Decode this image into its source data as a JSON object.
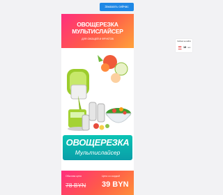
{
  "top_button": {
    "label": "Заказать сейчас"
  },
  "header": {
    "title_line1": "ОВОЩЕРЕЗКА",
    "title_line2": "МУЛЬТИСЛАЙСЕР",
    "subtitle": "ДЛЯ ОВОЩЕЙ И ФРУКТОВ"
  },
  "brand_banner": {
    "title": "ОВОЩЕРЕЗКА",
    "subtitle": "Мультислайсер"
  },
  "price": {
    "old_label": "Обычная цена",
    "new_label": "Цена со скидкой",
    "old_value": "78 BYN",
    "new_value": "39 BYN"
  },
  "widget": {
    "label_line1": "Сейчас на сайте",
    "count": "18",
    "unit": "чел."
  },
  "colors": {
    "accent_pink": "#ff2e7e",
    "accent_orange": "#ffa23a",
    "teal": "#0bc4b4",
    "button_blue": "#1e88e5",
    "slicer_green": "#9ccc2c"
  }
}
